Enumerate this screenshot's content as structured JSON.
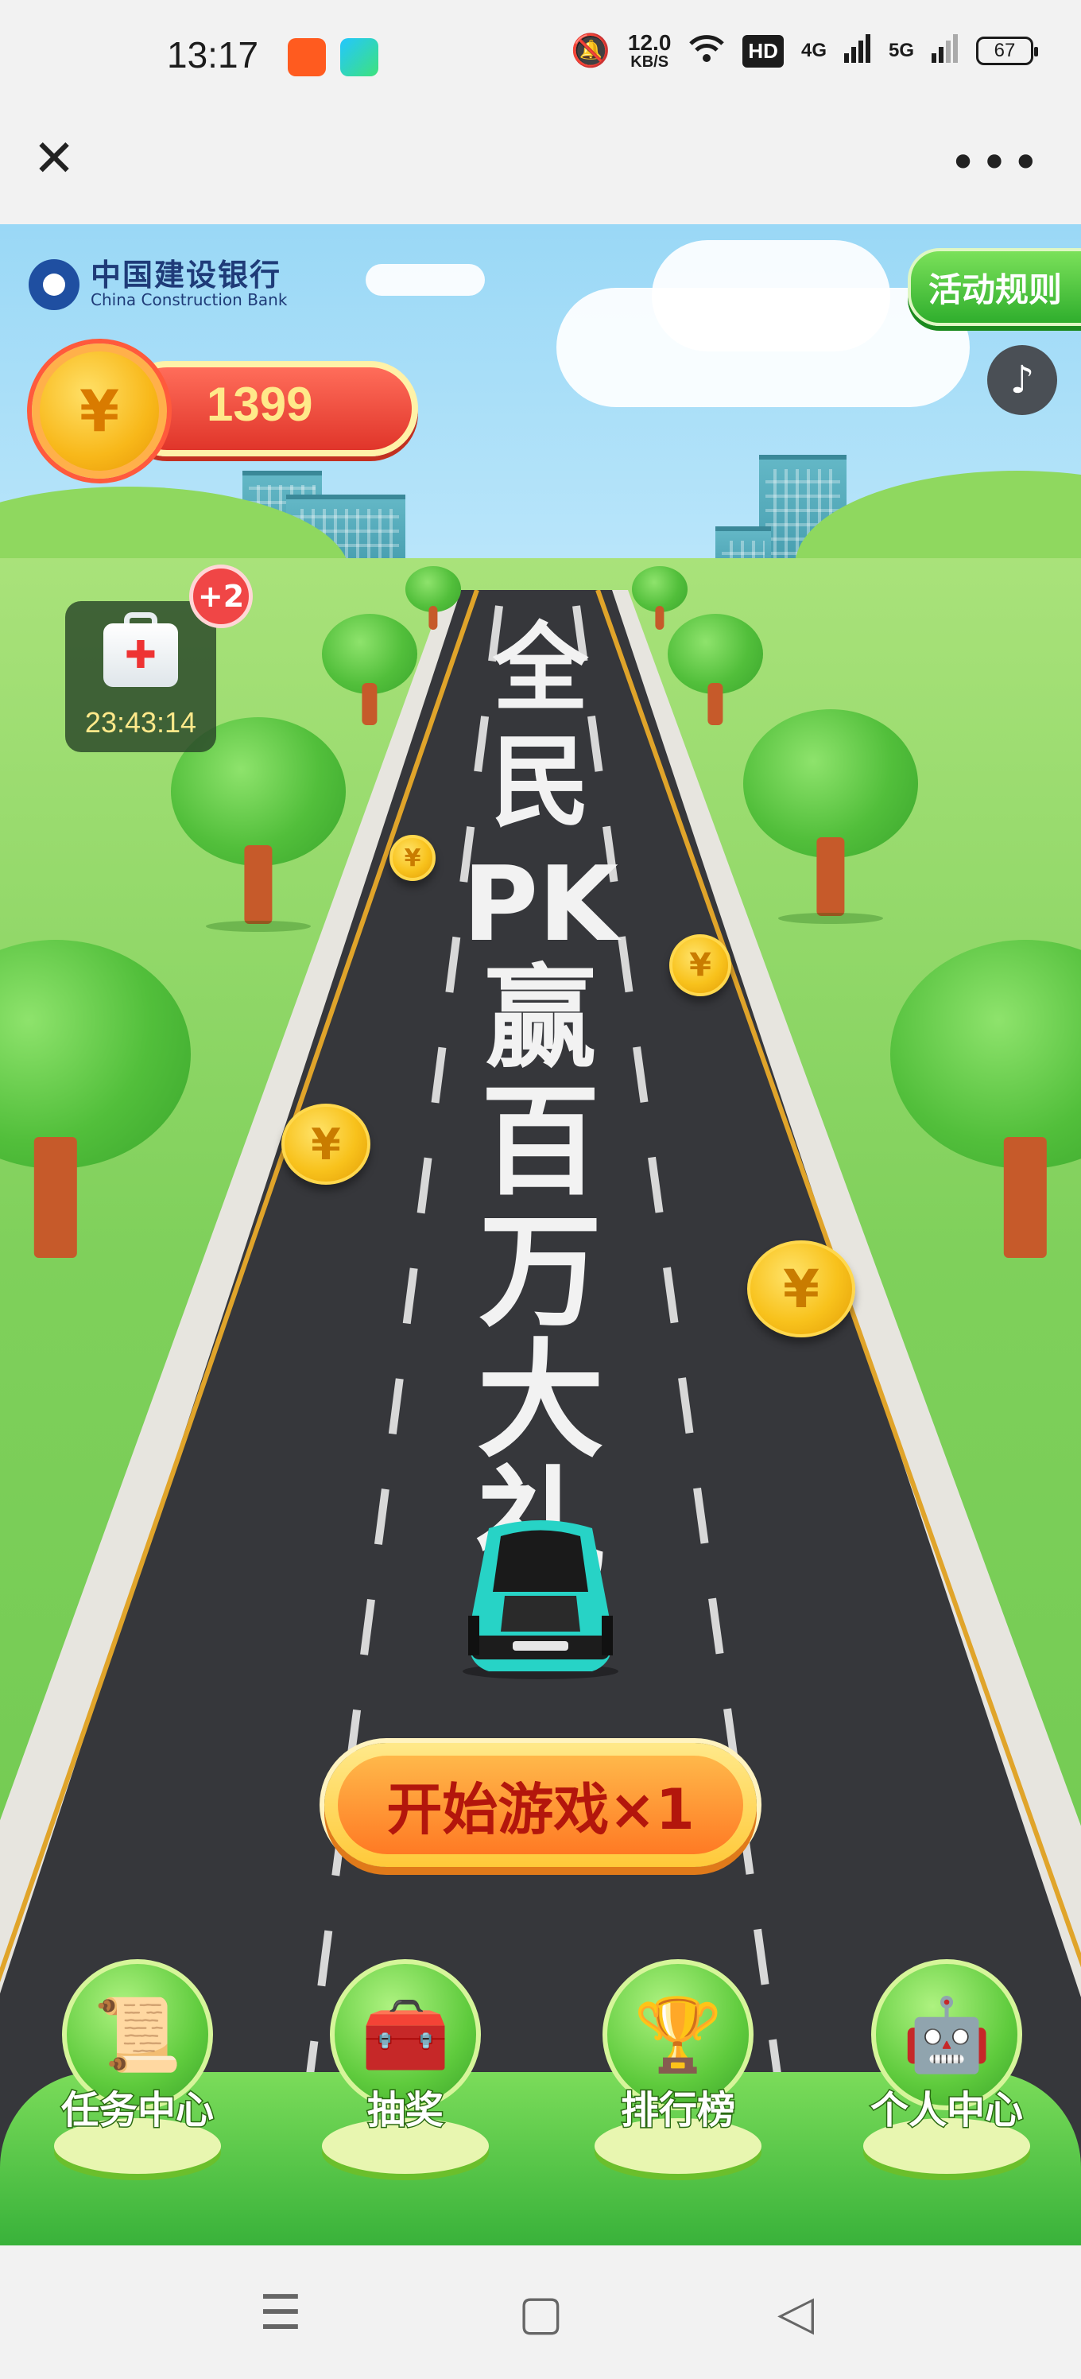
{
  "status_bar": {
    "time": "13:17",
    "net_speed_value": "12.0",
    "net_speed_unit": "KB/S",
    "hd_label": "HD",
    "signal_1_label": "4G",
    "signal_2_label": "5G",
    "battery": "67",
    "icons": [
      "mute-icon",
      "wifi-icon",
      "signal-icon"
    ]
  },
  "navbar": {
    "close_icon": "close-icon",
    "more_icon": "more-icon"
  },
  "bank": {
    "name_cn": "中国建设银行",
    "name_en": "China Construction Bank"
  },
  "header": {
    "rules_label": "活动规则",
    "coin_count": "1399",
    "coin_symbol": "¥"
  },
  "kit": {
    "badge": "+2",
    "timer": "23:43:14"
  },
  "slogan": [
    "全",
    "民",
    "PK",
    "赢",
    "百",
    "万",
    "大",
    "礼"
  ],
  "start_button": {
    "label": "开始游戏×1"
  },
  "tabs": [
    {
      "label": "任务中心",
      "icon": "task-icon"
    },
    {
      "label": "抽奖",
      "icon": "treasure-chest-icon"
    },
    {
      "label": "排行榜",
      "icon": "trophy-icon"
    },
    {
      "label": "个人中心",
      "icon": "robot-icon"
    }
  ],
  "colors": {
    "sky": "#9ad8f6",
    "grass": "#7fd05b",
    "road": "#3a3b3f",
    "accent": "#ff7a24"
  }
}
